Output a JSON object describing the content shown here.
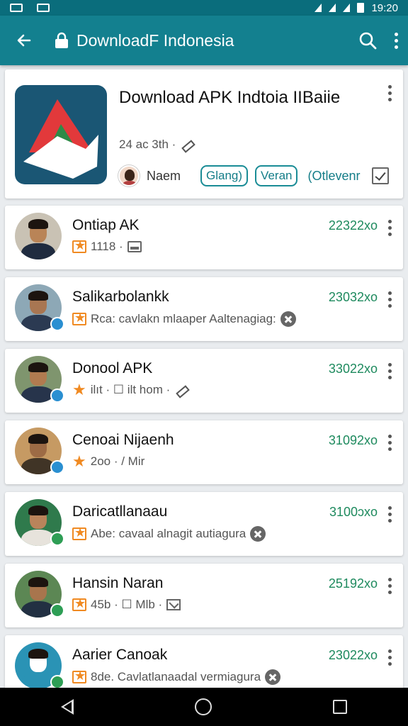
{
  "status_bar": {
    "time": "19:20"
  },
  "app_bar": {
    "title": "DownloadF Indonesia"
  },
  "hero": {
    "title": "Download APK Indtoia IIBaiie",
    "meta": "24 ac 3th ·",
    "author": "Naem",
    "chips": [
      "Glang)",
      "Veran"
    ],
    "link": "(Otlevenr"
  },
  "items": [
    {
      "title": "Ontiap AK",
      "subtitle": "1118 ·",
      "size": "22322xo",
      "rating_icon": "star-outline-icon",
      "extra_icon": "pc-icon",
      "badge_color": "none",
      "avatar_bg": "#c9c2b4",
      "avatar_skin": "#b98457",
      "avatar_body": "#1f2b3f"
    },
    {
      "title": "Salikarbolankk",
      "subtitle": "Rca: cavlakn mlaaper Aaltenagiag:",
      "size": "23032xo",
      "rating_icon": "star-outline-icon",
      "extra_icon": "cross-circle-icon",
      "badge_color": "blue",
      "avatar_bg": "#8da8b6",
      "avatar_skin": "#a87652",
      "avatar_body": "#2b3a52"
    },
    {
      "title": "Donool APK",
      "subtitle": "ilıt · ☐ ilt hom ·",
      "size": "33022xo",
      "rating_icon": "star-icon",
      "extra_icon": "pen-icon",
      "badge_color": "blue",
      "avatar_bg": "#7f956e",
      "avatar_skin": "#b17b50",
      "avatar_body": "#27344b"
    },
    {
      "title": "Cenoai Nijaenh",
      "subtitle": "2oo · / Mir",
      "size": "31092xo",
      "rating_icon": "star-icon",
      "extra_icon": "none",
      "badge_color": "blue",
      "avatar_bg": "#c69a63",
      "avatar_skin": "#9d6b45",
      "avatar_body": "#403426"
    },
    {
      "title": "Daricatllanaau",
      "subtitle": "Abe: cavaal alnagit autiagura",
      "size": "3100ɔxo",
      "rating_icon": "star-outline-icon",
      "extra_icon": "cross-circle-icon",
      "badge_color": "green",
      "avatar_bg": "#2f7a4c",
      "avatar_skin": "#b9845b",
      "avatar_body": "#e7e3dc"
    },
    {
      "title": "Hansin Naran",
      "subtitle": "45b · ☐ Mlb ·",
      "size": "25192xo",
      "rating_icon": "star-outline-icon",
      "extra_icon": "mail-icon",
      "badge_color": "green",
      "avatar_bg": "#5c8754",
      "avatar_skin": "#a8754d",
      "avatar_body": "#223042"
    },
    {
      "title": "Aarier Canoak",
      "subtitle": "8de. Cavlatlanaadal vermiagura",
      "size": "23022xo",
      "rating_icon": "star-outline-icon",
      "extra_icon": "cross-circle-icon",
      "badge_color": "green",
      "avatar_bg": "#2a93b5",
      "avatar_skin": "#ffffff",
      "avatar_body": "#2a93b5"
    }
  ]
}
